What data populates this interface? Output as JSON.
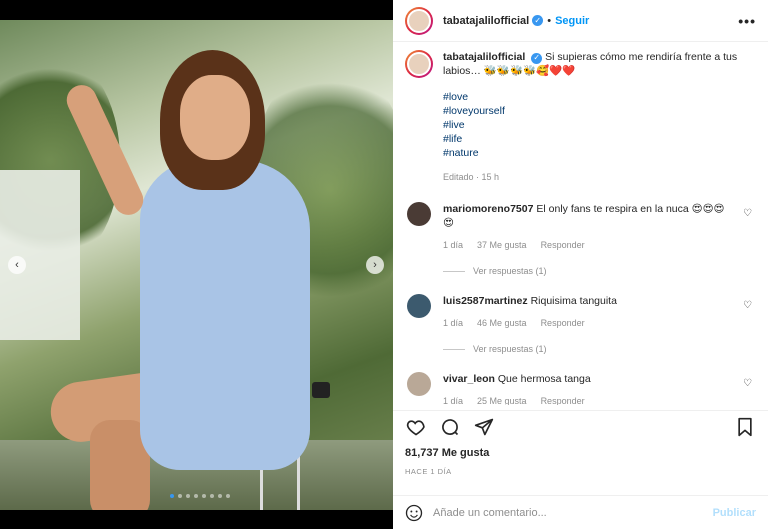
{
  "post": {
    "username": "tabatajalilofficial",
    "follow_label": "Seguir",
    "separator": "•",
    "more_label": "•••",
    "caption": "Si supieras cómo me rendiría frente a tus labios… 🐝🐝🐝🐝🥰❤️❤️",
    "hashtags": [
      "#love",
      "#loveyourself",
      "#live",
      "#life",
      "#nature"
    ],
    "caption_meta": "Editado · 15 h",
    "likes": "81,737 Me gusta",
    "posted": "HACE 1 DÍA"
  },
  "carousel": {
    "prev": "‹",
    "next": "›",
    "slide_count": 8,
    "active_index": 0
  },
  "comments": [
    {
      "username": "mariomoreno7507",
      "text": "El only fans te respira en la nuca 😍😍😍😍",
      "age": "1 día",
      "likes": "37 Me gusta",
      "reply": "Responder",
      "view_replies": "Ver respuestas (1)",
      "avatar_color": "#4a3b35"
    },
    {
      "username": "luis2587martinez",
      "text": "Riquisima tanguita",
      "age": "1 día",
      "likes": "46 Me gusta",
      "reply": "Responder",
      "view_replies": "Ver respuestas (1)",
      "avatar_color": "#3c5a6e"
    },
    {
      "username": "vivar_leon",
      "text": "Que hermosa tanga",
      "age": "1 día",
      "likes": "25 Me gusta",
      "reply": "Responder",
      "view_replies": "",
      "avatar_color": "#b9a897"
    }
  ],
  "composer": {
    "placeholder": "Añade un comentario...",
    "publish": "Publicar"
  },
  "colors": {
    "link": "#0095f6",
    "verified": "#3897f0",
    "hashtag": "#00376b"
  }
}
